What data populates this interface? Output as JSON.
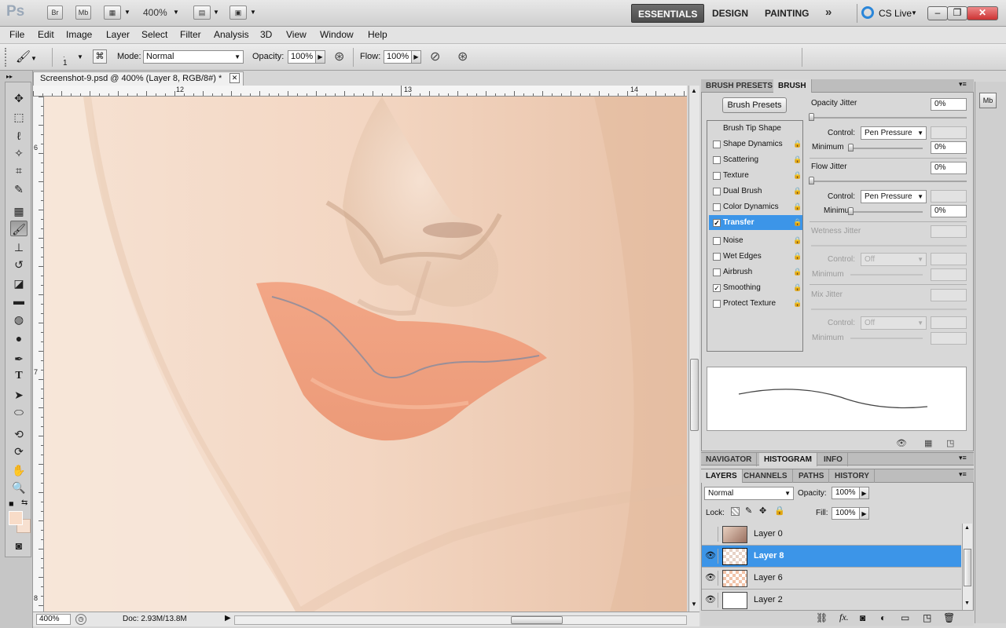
{
  "app": {
    "logo": "Ps",
    "br": "Br",
    "mb": "Mb",
    "zoom": "400%"
  },
  "workspaces": [
    "ESSENTIALS",
    "DESIGN",
    "PAINTING"
  ],
  "cs_live": "CS Live",
  "menu": [
    "File",
    "Edit",
    "Image",
    "Layer",
    "Select",
    "Filter",
    "Analysis",
    "3D",
    "View",
    "Window",
    "Help"
  ],
  "options": {
    "brush_size": "1",
    "mode_label": "Mode:",
    "mode_value": "Normal",
    "opacity_label": "Opacity:",
    "opacity_value": "100%",
    "flow_label": "Flow:",
    "flow_value": "100%"
  },
  "document": {
    "tab_title": "Screenshot-9.psd @ 400% (Layer 8, RGB/8#) *",
    "ruler_h": [
      "12",
      "13",
      "14"
    ],
    "ruler_v": [
      "6",
      "7",
      "8"
    ]
  },
  "status": {
    "zoom": "400%",
    "doc": "Doc: 2.93M/13.8M"
  },
  "brush_panel": {
    "tabs": [
      "BRUSH PRESETS",
      "BRUSH"
    ],
    "presets_button": "Brush Presets",
    "tip_shape": "Brush Tip Shape",
    "items": [
      {
        "label": "Shape Dynamics",
        "checked": false
      },
      {
        "label": "Scattering",
        "checked": false
      },
      {
        "label": "Texture",
        "checked": false
      },
      {
        "label": "Dual Brush",
        "checked": false
      },
      {
        "label": "Color Dynamics",
        "checked": false
      },
      {
        "label": "Transfer",
        "checked": true,
        "selected": true
      },
      {
        "label": "Noise",
        "checked": false
      },
      {
        "label": "Wet Edges",
        "checked": false
      },
      {
        "label": "Airbrush",
        "checked": false
      },
      {
        "label": "Smoothing",
        "checked": true
      },
      {
        "label": "Protect Texture",
        "checked": false
      }
    ],
    "opacity_jitter": {
      "label": "Opacity Jitter",
      "value": "0%",
      "control_label": "Control:",
      "control": "Pen Pressure",
      "minimum_label": "Minimum",
      "minimum": "0%"
    },
    "flow_jitter": {
      "label": "Flow Jitter",
      "value": "0%",
      "control_label": "Control:",
      "control": "Pen Pressure",
      "minimum_label": "Minimu",
      "minimum": "0%"
    },
    "wetness_jitter": {
      "label": "Wetness Jitter",
      "control_label": "Control:",
      "control": "Off",
      "minimum_label": "Minimum"
    },
    "mix_jitter": {
      "label": "Mix Jitter",
      "control_label": "Control:",
      "control": "Off",
      "minimum_label": "Minimum"
    }
  },
  "nav_tabs": [
    "NAVIGATOR",
    "HISTOGRAM",
    "INFO"
  ],
  "layers_panel": {
    "tabs": [
      "LAYERS",
      "CHANNELS",
      "PATHS",
      "HISTORY"
    ],
    "blend_mode": "Normal",
    "opacity_label": "Opacity:",
    "opacity": "100%",
    "lock_label": "Lock:",
    "fill_label": "Fill:",
    "fill": "100%",
    "layers": [
      {
        "name": "Layer 0",
        "visible": false,
        "selected": false
      },
      {
        "name": "Layer 8",
        "visible": true,
        "selected": true
      },
      {
        "name": "Layer 6",
        "visible": true,
        "selected": false
      },
      {
        "name": "Layer 2",
        "visible": true,
        "selected": false
      }
    ]
  },
  "colors": {
    "accent": "#3c95e8",
    "lip": "#ee9f7e",
    "skin": "#f2d6c3"
  }
}
